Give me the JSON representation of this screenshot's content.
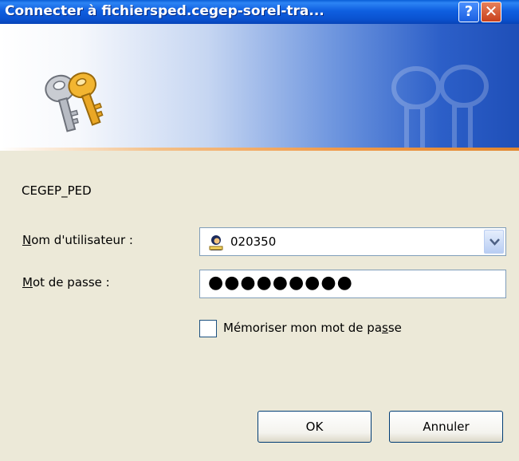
{
  "window": {
    "title": "Connecter à fichiersped.cegep-sorel-tra...",
    "help_label": "?",
    "close_label": "✕"
  },
  "dialog": {
    "domain_text": "CEGEP_PED",
    "username_label_mnemonic": "N",
    "username_label_rest": "om d'utilisateur :",
    "username_value": "020350",
    "password_label_mnemonic": "M",
    "password_label_rest": "ot de passe :",
    "password_masked": "●●●●●●●●●",
    "remember_label_before": "Mémoriser mon mot de pa",
    "remember_label_mnemonic": "s",
    "remember_label_after": "se",
    "remember_checked": false,
    "ok_label": "OK",
    "cancel_label": "Annuler"
  },
  "icons": {
    "banner": "keys-icon",
    "user": "user-icon",
    "dropdown": "chevron-down-icon"
  }
}
